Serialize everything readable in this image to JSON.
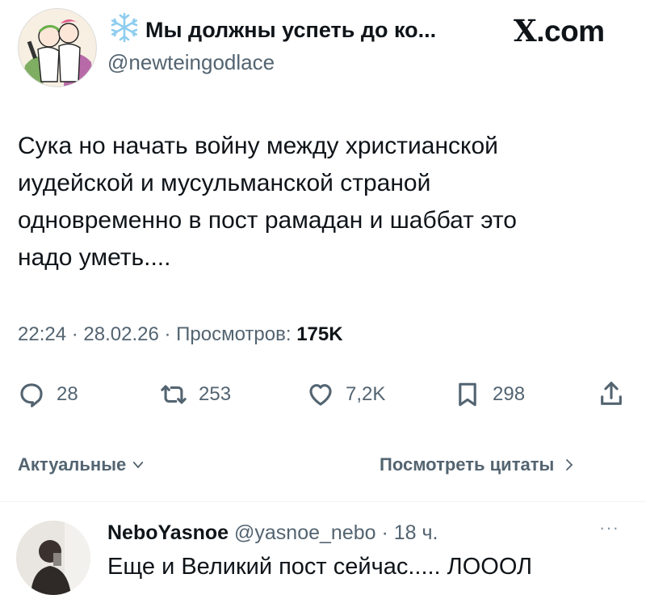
{
  "header": {
    "display_name": "Мы должны успеть до ко...",
    "handle": "@newteingodlace",
    "site": ".com",
    "site_x": "X",
    "name_emoji": "snowflake-icon"
  },
  "tweet": {
    "lines": [
      "Сука но начать войну между христианской",
      "иудейской и мусульманской страной",
      "одновременно в пост рамадан и шаббат это",
      "надо уметь...."
    ],
    "time": "22:24",
    "date": "28.02.26",
    "views_label": "Просмотров:",
    "views": "175K"
  },
  "actions": {
    "replies": "28",
    "reposts": "253",
    "likes": "7,2K",
    "bookmarks": "298"
  },
  "sort": {
    "label": "Актуальные",
    "quotes_label": "Посмотреть цитаты"
  },
  "reply": {
    "name": "NeboYasnoe",
    "handle": "@yasnoe_nebo",
    "time": "18 ч.",
    "text": "Еще и Великий пост сейчас..... ЛОООЛ"
  },
  "colors": {
    "text": "#0f1419",
    "secondary": "#536471",
    "divider": "#eff3f4",
    "snowflake": "#8ecdf0"
  }
}
